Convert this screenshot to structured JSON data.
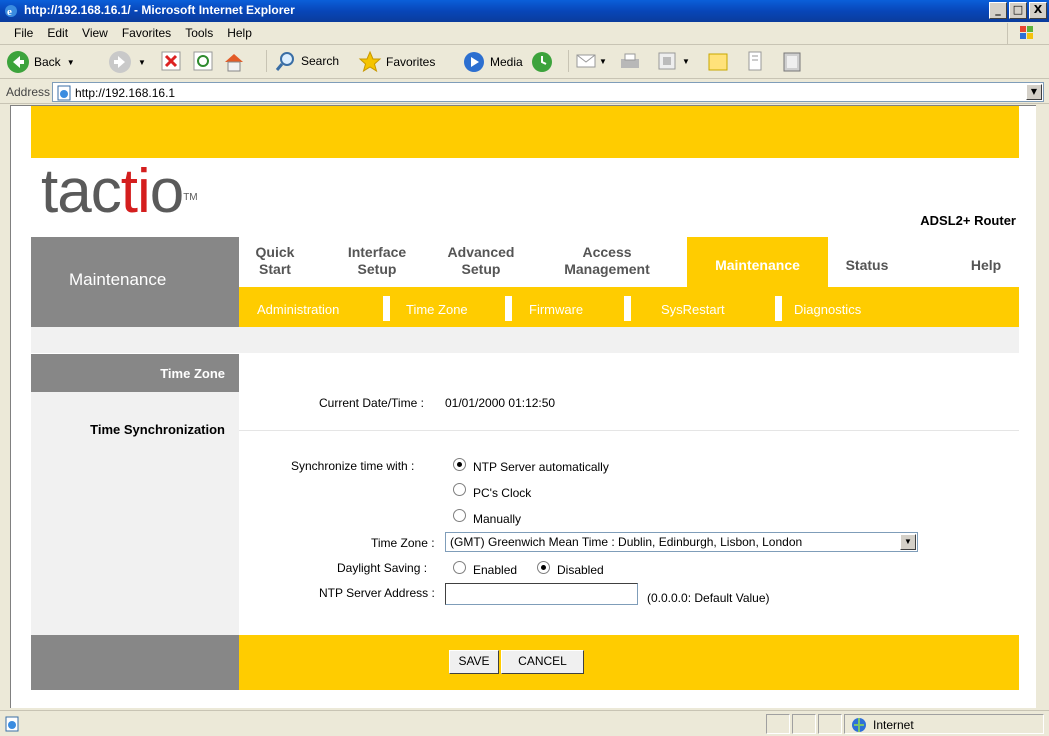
{
  "window": {
    "title": "http://192.168.16.1/ - Microsoft Internet Explorer",
    "min": "_",
    "max": "□",
    "close": "X"
  },
  "menu": [
    "File",
    "Edit",
    "View",
    "Favorites",
    "Tools",
    "Help"
  ],
  "toolbar": {
    "back": "Back",
    "search": "Search",
    "favorites": "Favorites",
    "media": "Media"
  },
  "address": {
    "label": "Address",
    "url": "http://192.168.16.1"
  },
  "page": {
    "logo_prefix": "tac",
    "logo_accent": "ti",
    "logo_suffix": "o",
    "logo_tm": "TM",
    "product": "ADSL2+ Router",
    "section": "Maintenance",
    "nav": [
      {
        "l1": "Quick",
        "l2": "Start"
      },
      {
        "l1": "Interface",
        "l2": "Setup"
      },
      {
        "l1": "Advanced",
        "l2": "Setup"
      },
      {
        "l1": "Access",
        "l2": "Management"
      },
      {
        "l1": "Maintenance",
        "l2": ""
      },
      {
        "l1": "Status",
        "l2": ""
      },
      {
        "l1": "Help",
        "l2": ""
      }
    ],
    "subnav": [
      "Administration",
      "Time Zone",
      "Firmware",
      "SysRestart",
      "Diagnostics"
    ],
    "side": {
      "time_zone": "Time Zone",
      "time_sync": "Time Synchronization"
    },
    "current_label": "Current Date/Time :",
    "current_value": "01/01/2000 01:12:50",
    "sync_label": "Synchronize time with :",
    "sync_options": [
      "NTP Server automatically",
      "PC's Clock",
      "Manually"
    ],
    "tz_label": "Time Zone :",
    "tz_value": "(GMT) Greenwich Mean Time : Dublin, Edinburgh, Lisbon, London",
    "dst_label": "Daylight Saving :",
    "dst_options": [
      "Enabled",
      "Disabled"
    ],
    "ntp_label": "NTP Server Address :",
    "ntp_value": "",
    "ntp_hint": "(0.0.0.0: Default Value)",
    "save": "SAVE",
    "cancel": "CANCEL"
  },
  "status": {
    "zone": "Internet"
  },
  "colors": {
    "yellow": "#FFCC00",
    "grey": "#878787",
    "logo_red": "#D41E1E"
  }
}
